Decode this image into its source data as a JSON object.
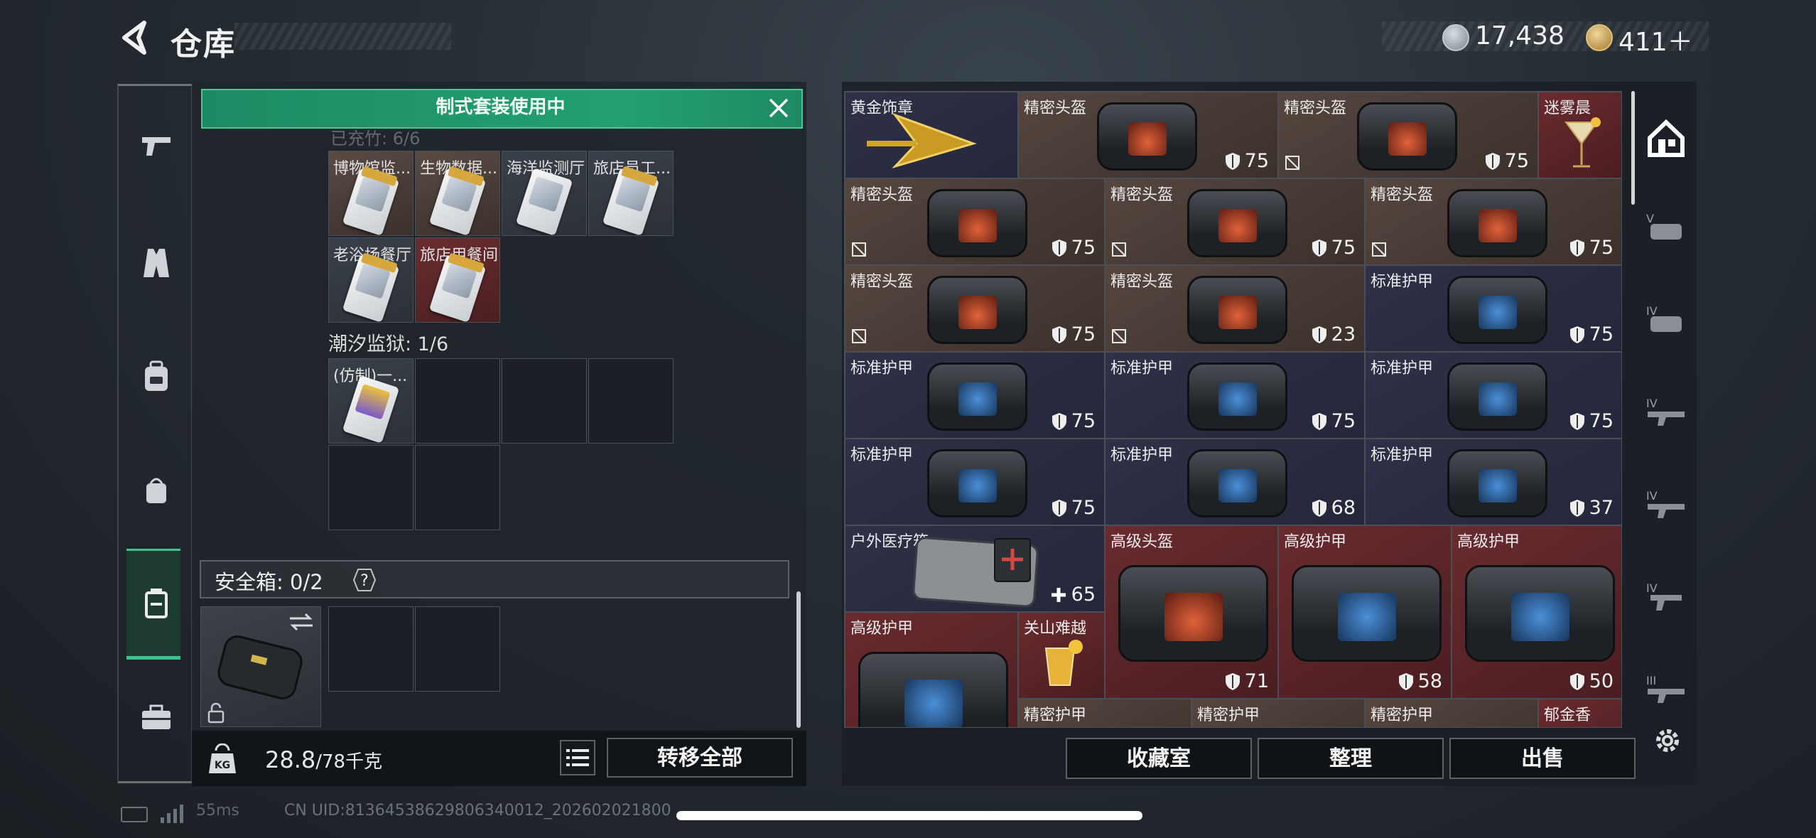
{
  "header": {
    "title": "仓库",
    "currency1": "17,438",
    "currency2": "411＋"
  },
  "left_panel": {
    "banner": "制式套装使用中",
    "ghost_text": "已充竹: 6/6",
    "keycards_row1": [
      "博物馆监...",
      "生物数据...",
      "海洋监测厅",
      "旅店员工..."
    ],
    "keycards_row2": [
      "老浴场餐厅",
      "旅店用餐间"
    ],
    "prison_section": "潮汐监狱: 1/6",
    "prison_card": "(仿制)一...",
    "safe_label": "安全箱: 0/2",
    "safe_help": "?",
    "weight_value": "28.8",
    "weight_unit": "/78千克",
    "transfer_all": "转移全部"
  },
  "grid": {
    "items": [
      {
        "label": "黄金饰章",
        "durability": ""
      },
      {
        "label": "精密头盔",
        "durability": "75"
      },
      {
        "label": "精密头盔",
        "durability": "75"
      },
      {
        "label": "迷雾晨",
        "durability": ""
      },
      {
        "label": "精密头盔",
        "durability": "75"
      },
      {
        "label": "精密头盔",
        "durability": "75"
      },
      {
        "label": "精密头盔",
        "durability": "75"
      },
      {
        "label": "精密头盔",
        "durability": "75"
      },
      {
        "label": "精密头盔",
        "durability": "23"
      },
      {
        "label": "标准护甲",
        "durability": "75"
      },
      {
        "label": "标准护甲",
        "durability": "75"
      },
      {
        "label": "标准护甲",
        "durability": "75"
      },
      {
        "label": "标准护甲",
        "durability": "75"
      },
      {
        "label": "标准护甲",
        "durability": "75"
      },
      {
        "label": "标准护甲",
        "durability": "68"
      },
      {
        "label": "标准护甲",
        "durability": "37"
      },
      {
        "label": "户外医疗箱",
        "durability": "65"
      },
      {
        "label": "高级头盔",
        "durability": "71"
      },
      {
        "label": "高级护甲",
        "durability": "58"
      },
      {
        "label": "高级护甲",
        "durability": "50"
      },
      {
        "label": "高级护甲",
        "durability": ""
      },
      {
        "label": "关山难越",
        "durability": ""
      },
      {
        "label": "精密护甲",
        "durability": ""
      },
      {
        "label": "精密护甲",
        "durability": ""
      },
      {
        "label": "精密护甲",
        "durability": ""
      },
      {
        "label": "郁金香",
        "durability": ""
      }
    ]
  },
  "right_footer": {
    "collection": "收藏室",
    "sort": "整理",
    "sell": "出售"
  },
  "right_tabs": [
    "V",
    "IV",
    "IV",
    "IV",
    "IV",
    "III"
  ],
  "status": {
    "ping": "55ms",
    "uid": "CN UID:8136453862980634001​2_202602021800"
  },
  "colors": {
    "accent_green": "#23a170",
    "rarity_brown": "#55463f",
    "rarity_purple": "#2f3148",
    "rarity_red": "#6a2b2f"
  }
}
